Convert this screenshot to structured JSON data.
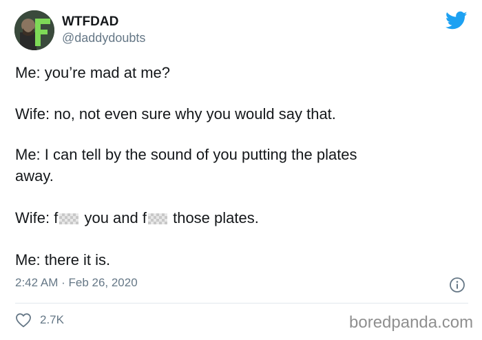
{
  "author": {
    "display_name": "WTFDAD",
    "handle": "@daddydoubts"
  },
  "tweet": {
    "line1": "Me: you’re mad at me?",
    "line2": "Wife: no, not even sure why you would say that.",
    "line3a": "Me: I can tell by the sound of you putting the plates",
    "line3b": "away.",
    "line4_prefix": "Wife: f",
    "line4_mid": " you and f",
    "line4_suffix": " those plates.",
    "line5": "Me: there it is."
  },
  "meta": {
    "timestamp": "2:42 AM · Feb 26, 2020"
  },
  "actions": {
    "like_count": "2.7K"
  },
  "watermark": "boredpanda.com",
  "colors": {
    "twitter_blue": "#1da1f2",
    "muted": "#657786",
    "text": "#14171a"
  },
  "icons": {
    "bird": "twitter-bird-icon",
    "info": "info-icon",
    "heart": "heart-icon"
  }
}
